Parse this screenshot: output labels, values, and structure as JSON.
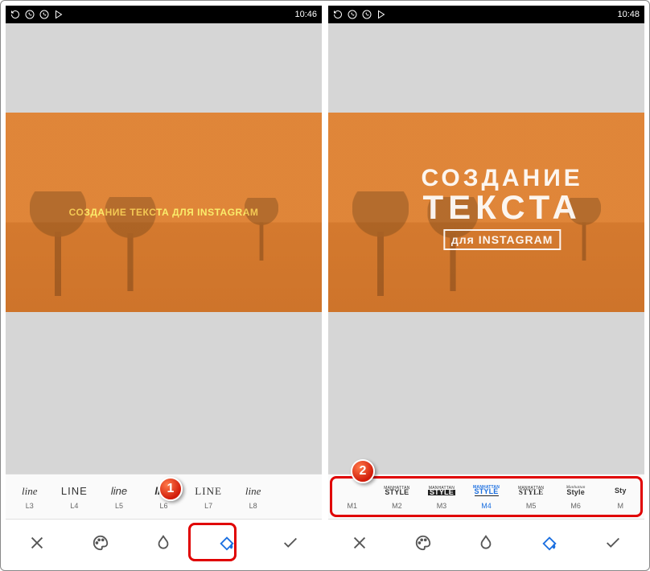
{
  "left": {
    "status": {
      "time": "10:46"
    },
    "overlay": {
      "text": "СОЗДАНИЕ ТЕКСТА ДЛЯ INSTAGRAM"
    },
    "styles": [
      {
        "preview": "line",
        "code": "L3",
        "css": "font-style:italic;font-family:Georgia,serif;"
      },
      {
        "preview": "LINE",
        "code": "L4",
        "css": "font-weight:300;letter-spacing:1px;"
      },
      {
        "preview": "line",
        "code": "L5",
        "css": "font-style:italic;"
      },
      {
        "preview": "line",
        "code": "L6",
        "css": "font-weight:700;font-style:italic;",
        "selected": false
      },
      {
        "preview": "LINE",
        "code": "L7",
        "css": "font-weight:300;letter-spacing:1px;font-family:Georgia,serif;"
      },
      {
        "preview": "line",
        "code": "L8",
        "css": "font-style:italic;font-family:Georgia,serif;font-weight:300;"
      },
      {
        "preview": "",
        "code": "",
        "css": ""
      }
    ],
    "callout": {
      "num": "1"
    }
  },
  "right": {
    "status": {
      "time": "10:48"
    },
    "overlay": {
      "line1": "СОЗДАНИЕ",
      "line2": "ТЕКСТА",
      "line3": "для INSTAGRAM"
    },
    "styles": [
      {
        "top": "",
        "bot": "",
        "code": "M1",
        "variant": ""
      },
      {
        "top": "MANHATTAN",
        "bot": "STYLE",
        "code": "M2",
        "variant": ""
      },
      {
        "top": "MANHATTAN",
        "bot": "STYLE",
        "code": "M3",
        "variant": "box"
      },
      {
        "top": "MANHATTAN",
        "bot": "STYLE",
        "code": "M4",
        "variant": "under",
        "selected": true
      },
      {
        "top": "MANHATTAN",
        "bot": "STYLE",
        "code": "M5",
        "variant": "rough"
      },
      {
        "top": "Manhattan",
        "bot": "Style",
        "code": "M6",
        "variant": "script"
      },
      {
        "top": "",
        "bot": "Sty",
        "code": "M",
        "variant": "script"
      }
    ],
    "callout": {
      "num": "2"
    }
  },
  "toolbar_icons": {
    "close": "close-icon",
    "palette": "palette-icon",
    "drop": "drop-icon",
    "bucket": "paint-bucket-icon",
    "check": "check-icon"
  }
}
